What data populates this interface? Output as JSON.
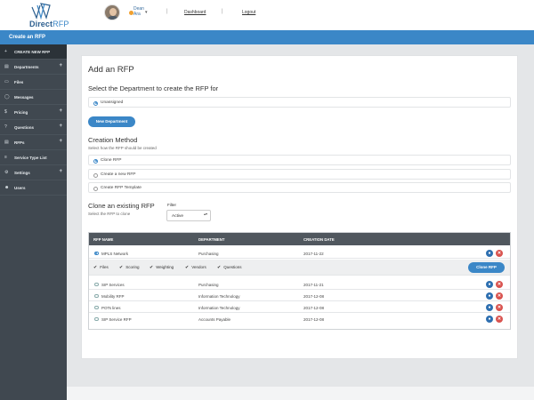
{
  "header": {
    "logo_main": "Direct",
    "logo_accent": "RFP",
    "user_first": "Dean",
    "user_last": "Ara",
    "caret": "▾",
    "separator": "|",
    "nav": [
      "Dashboard",
      "Logout"
    ]
  },
  "bar": {
    "title": "Create an RFP"
  },
  "sidebar": {
    "items": [
      {
        "icon": "+",
        "label": "CREATE NEW RFP",
        "plus": ""
      },
      {
        "icon": "▤",
        "label": "Departments",
        "plus": "+"
      },
      {
        "icon": "▭",
        "label": "Files",
        "plus": ""
      },
      {
        "icon": "◯",
        "label": "Messages",
        "plus": ""
      },
      {
        "icon": "$",
        "label": "Pricing",
        "plus": "+"
      },
      {
        "icon": "?",
        "label": "Questions",
        "plus": "+"
      },
      {
        "icon": "▤",
        "label": "RFPs",
        "plus": "+"
      },
      {
        "icon": "≡",
        "label": "Service Type List",
        "plus": ""
      },
      {
        "icon": "⚙",
        "label": "Settings",
        "plus": "+"
      },
      {
        "icon": "☻",
        "label": "Users",
        "plus": ""
      }
    ]
  },
  "page": {
    "title": "Add an RFP",
    "dept_heading": "Select the Department to create the RFP for",
    "dept_selected": "Unassigned",
    "new_dept_button": "New Department",
    "method_heading": "Creation Method",
    "method_sub": "Select how the RFP should be created",
    "methods": [
      "Clone RFP",
      "Create a new RFP",
      "Create RFP Template"
    ],
    "clone_heading": "Clone an existing RFP",
    "clone_sub": "Select the RFP to clone",
    "filter_label": "Filter",
    "filter_value": "Active",
    "filter_caret": "▴▾"
  },
  "table": {
    "headers": [
      "RFP NAME",
      "DEPARTMENT",
      "CREATION DATE"
    ],
    "rows": [
      {
        "name": "MPLS Network",
        "dept": "Purchasing",
        "date": "2017-11-22"
      },
      {
        "name": "SIP Services",
        "dept": "Purchasing",
        "date": "2017-11-21"
      },
      {
        "name": "Mobility RFP",
        "dept": "Information Technology",
        "date": "2017-12-08"
      },
      {
        "name": "POTs lines",
        "dept": "Information Technology",
        "date": "2017-12-08"
      },
      {
        "name": "SIP Service RFP",
        "dept": "Accounts Payable",
        "date": "2017-12-08"
      }
    ],
    "clone_options": [
      "Files",
      "Scoring",
      "Weighting",
      "Vendors",
      "Questions"
    ],
    "check_glyph": "✔",
    "clone_button": "Clone RFP",
    "view_glyph": "●",
    "delete_glyph": "✕"
  },
  "colors": {
    "accent": "#3b87c7",
    "sidebar": "#404850",
    "danger": "#d9534f"
  }
}
